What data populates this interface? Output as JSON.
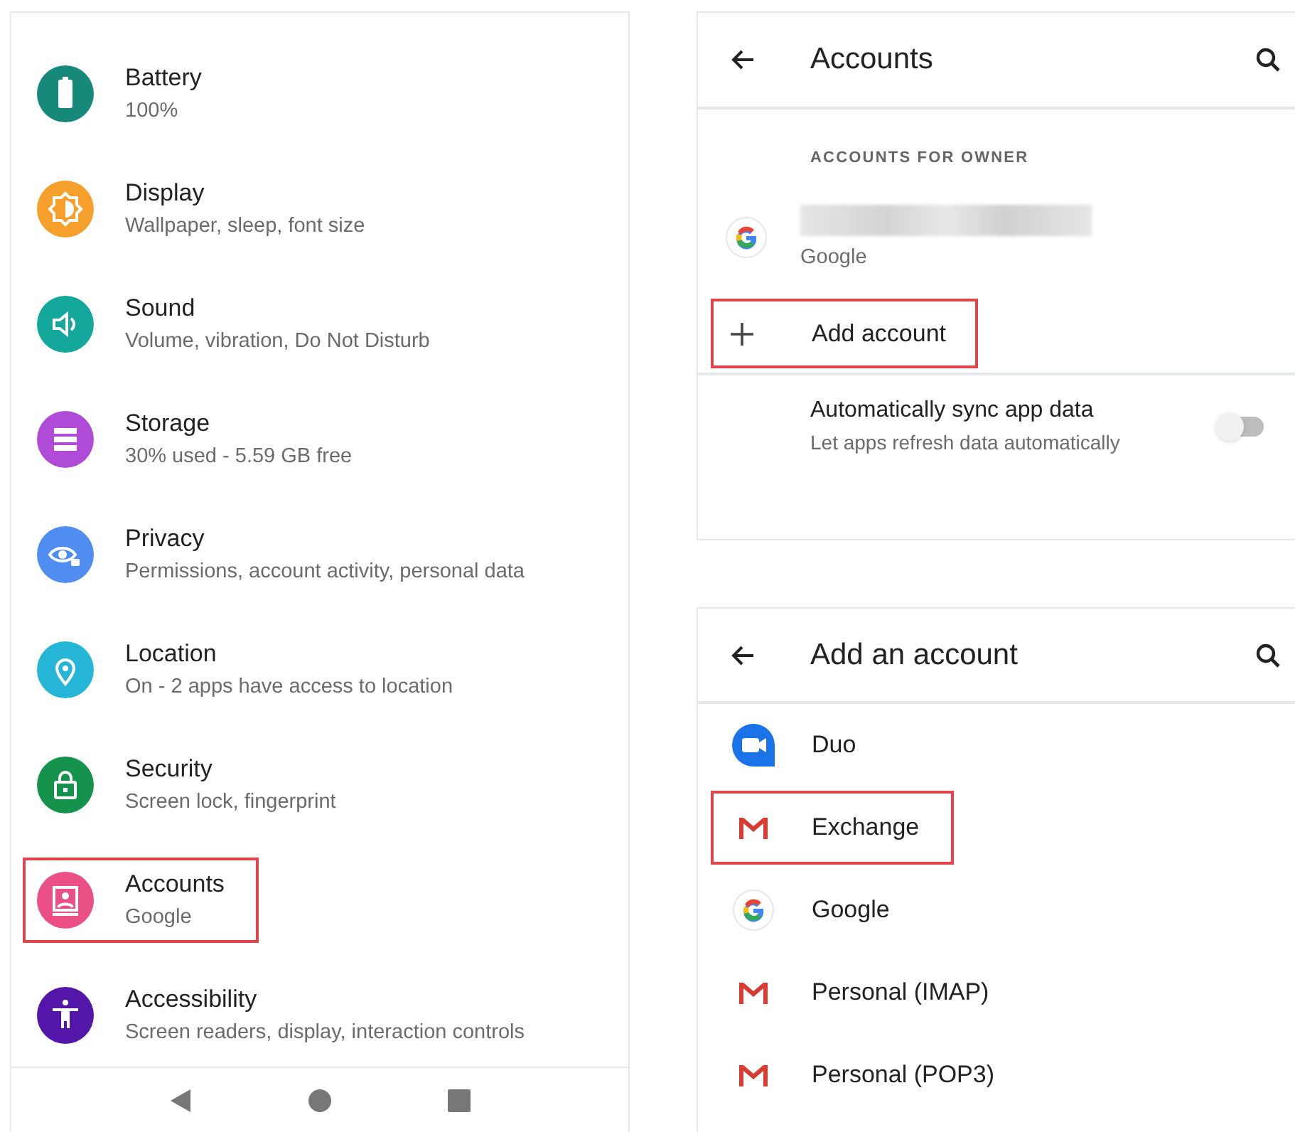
{
  "settings": {
    "items": [
      {
        "kind": "battery",
        "title": "Battery",
        "subtitle": "100%",
        "color": "#16897a",
        "highlighted": false
      },
      {
        "kind": "display",
        "title": "Display",
        "subtitle": "Wallpaper, sleep, font size",
        "color": "#f6a02b",
        "highlighted": false
      },
      {
        "kind": "sound",
        "title": "Sound",
        "subtitle": "Volume, vibration, Do Not Disturb",
        "color": "#14a79b",
        "highlighted": false
      },
      {
        "kind": "storage",
        "title": "Storage",
        "subtitle": "30% used - 5.59 GB free",
        "color": "#b04bd8",
        "highlighted": false
      },
      {
        "kind": "privacy",
        "title": "Privacy",
        "subtitle": "Permissions, account activity, personal data",
        "color": "#4f8ef0",
        "highlighted": false
      },
      {
        "kind": "location",
        "title": "Location",
        "subtitle": "On - 2 apps have access to location",
        "color": "#25b5d6",
        "highlighted": false
      },
      {
        "kind": "security",
        "title": "Security",
        "subtitle": "Screen lock, fingerprint",
        "color": "#15934d",
        "highlighted": false
      },
      {
        "kind": "accounts",
        "title": "Accounts",
        "subtitle": "Google",
        "color": "#ea4f86",
        "highlighted": true
      },
      {
        "kind": "accessibility",
        "title": "Accessibility",
        "subtitle": "Screen readers, display, interaction controls",
        "color": "#5316a8",
        "highlighted": false
      }
    ]
  },
  "accounts_screen": {
    "title": "Accounts",
    "section_label": "ACCOUNTS FOR OWNER",
    "account": {
      "kind": "google",
      "subtitle": "Google"
    },
    "add_account": {
      "label": "Add account",
      "highlighted": true
    },
    "sync": {
      "title": "Automatically sync app data",
      "subtitle": "Let apps refresh data automatically",
      "on": false
    }
  },
  "add_account_screen": {
    "title": "Add an account",
    "items": [
      {
        "kind": "duo",
        "label": "Duo",
        "highlighted": false
      },
      {
        "kind": "gmail",
        "label": "Exchange",
        "highlighted": true
      },
      {
        "kind": "google",
        "label": "Google",
        "highlighted": false
      },
      {
        "kind": "gmail",
        "label": "Personal (IMAP)",
        "highlighted": false
      },
      {
        "kind": "gmail",
        "label": "Personal (POP3)",
        "highlighted": false
      }
    ]
  }
}
